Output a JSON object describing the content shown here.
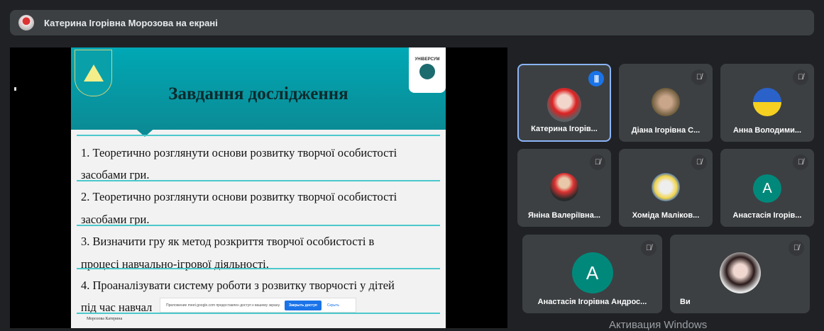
{
  "presenter_bar": {
    "text": "Катерина Ігорівна Морозова на екрані"
  },
  "slide": {
    "title": "Завдання дослідження",
    "logo_right_text": "УНІВЕРСУМ",
    "items": [
      "1. Теоретично розглянути основи розвитку творчої особистості",
      "засобами гри.",
      "2. Теоретично розглянути основи розвитку творчої особистості",
      "засобами гри.",
      "3. Визначити гру як метод розкриття творчої особистості в",
      "процесі навчально-ігрової діяльності.",
      "4. Проаналізувати систему роботи з розвитку творчості у дітей",
      "під час навчал"
    ],
    "footer": "Морозова Катерина"
  },
  "share_notice": {
    "text": "Приложение meet.google.com предоставлен доступ к вашему экрану.",
    "stop_label": "Закрыть доступ",
    "hide_label": "Скрыть"
  },
  "participants": [
    {
      "name": "Катерина Ігорів...",
      "speaking": true
    },
    {
      "name": "Діана Ігорівна С...",
      "muted": true
    },
    {
      "name": "Анна Володими...",
      "muted": true
    },
    {
      "name": "Яніна Валеріївна...",
      "muted": true
    },
    {
      "name": "Хоміда Маліков...",
      "muted": true
    },
    {
      "name": "Анастасія Ігорів...",
      "muted": true,
      "initial": "А"
    },
    {
      "name": "Анастасія Ігорівна Андрос...",
      "muted": true,
      "initial": "А"
    },
    {
      "name": "Ви",
      "muted": true
    }
  ],
  "watermark": "Активация Windows",
  "colors": {
    "active_border": "#8ab4f8",
    "avatar_letter_bg": "#00897b",
    "slide_teal": "#00a8b5"
  }
}
